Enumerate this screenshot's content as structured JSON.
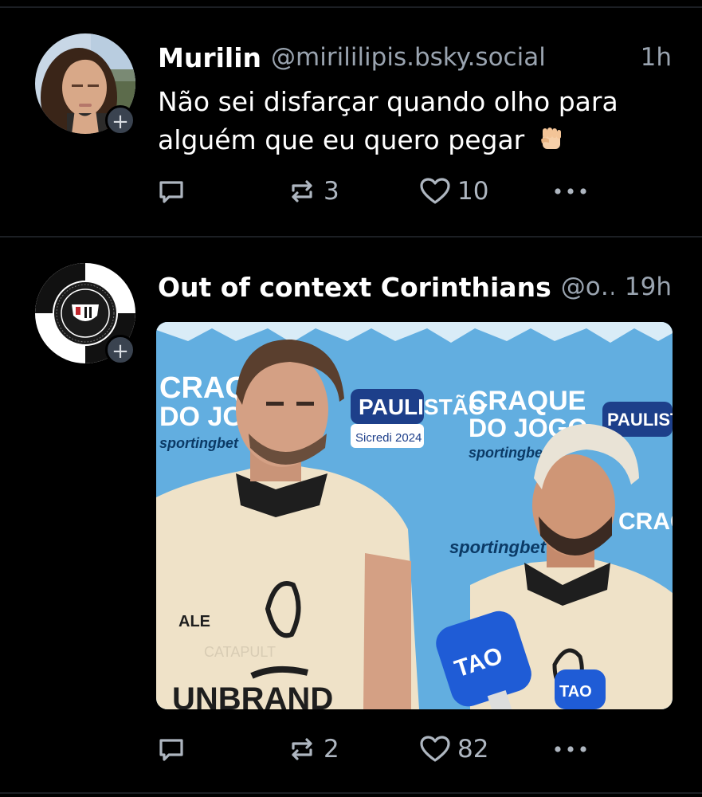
{
  "posts": [
    {
      "author": {
        "display_name": "Murilin",
        "handle": "@mirililipis.bsky.social"
      },
      "time": "1h",
      "text": "Não sei disfarçar quando olho para alguém que eu quero pegar",
      "text_emoji": "raised-fist",
      "actions": {
        "reply_count": "",
        "repost_count": "3",
        "like_count": "10"
      }
    },
    {
      "author": {
        "display_name": "Out of context Corinthians",
        "handle": "@o…"
      },
      "time": "19h",
      "media": {
        "backdrop_words": [
          "CRAQUE",
          "DO JOGO",
          "sportingbet",
          "PAULISTÃO",
          "Sicredi 2024"
        ],
        "shirt_sponsor": "ALE",
        "shirt_text": "CATAPULT",
        "shirt_bottom": "UNBRAND",
        "mic_brand": "TAO"
      },
      "actions": {
        "reply_count": "",
        "repost_count": "2",
        "like_count": "82"
      }
    }
  ],
  "colors": {
    "background": "#000000",
    "divider": "#1c1f24",
    "muted_text": "#9aa4b0",
    "badge": "#3a4350"
  }
}
